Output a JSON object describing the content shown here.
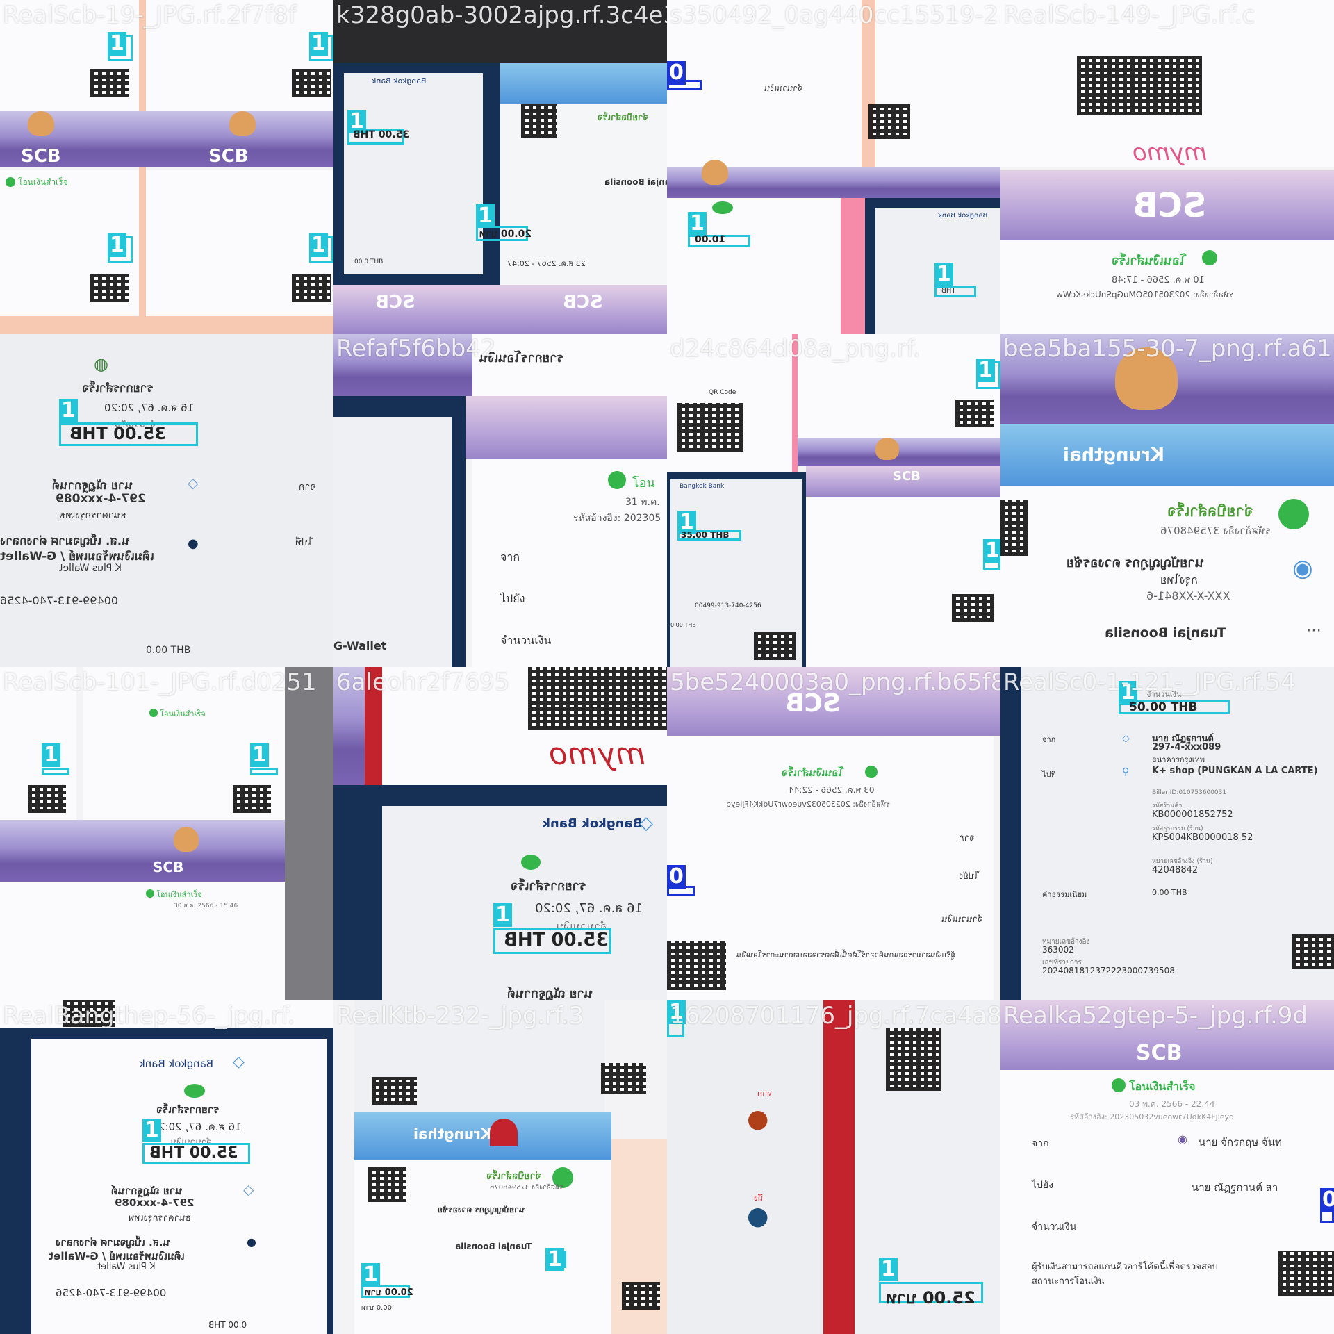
{
  "mosaic": {
    "tiles": [
      {
        "source": "RealScb-19-_JPG.rf.2f7f8f",
        "boxes": [
          {
            "label": "1",
            "value": ""
          },
          {
            "label": "1",
            "value": ""
          },
          {
            "label": "1",
            "value": ""
          },
          {
            "label": "1",
            "value": ""
          }
        ],
        "texts": [
          "โอนเงินสำเร็จ",
          "SCB",
          "SCB"
        ]
      },
      {
        "source": "k328g0ab-3002ajpg.rf.3c4e34",
        "boxes": [
          {
            "label": "1",
            "value": "35.00 THB"
          },
          {
            "label": "1",
            "value": "20.00 บาท"
          }
        ],
        "texts": [
          "Bangkok Bank",
          "จ่ายบิลสำเร็จ",
          "Tuanjai Boonsila",
          "23 ส.ค. 2567 - 20:47",
          "00.0 THB",
          "SCB",
          "SCB"
        ]
      },
      {
        "source": "s350492_0ag440cc15519-25fa6",
        "boxes": [
          {
            "label": "0",
            "value": ""
          },
          {
            "label": "1",
            "value": "10.00"
          },
          {
            "label": "1",
            "value": "THB"
          }
        ],
        "texts": [
          "จำนวนเงิน",
          "Bangkok Bank"
        ]
      },
      {
        "source": "RealScb-149-_JPG.rf.c",
        "boxes": [],
        "texts": [
          "SCB",
          "โอนเงินสำเร็จ",
          "10 พ.ค. 2566 - 17:48",
          "รหัสอ้างอิง: 202305105OMuGpSnUcksKcWw"
        ]
      },
      {
        "source": "",
        "boxes": [
          {
            "label": "1",
            "value": "35.00 THB"
          }
        ],
        "texts": [
          "รายการสำเร็จ",
          "16 ส.ค. 67, 20:20",
          "จำนวนเงิน",
          "นาย ณัฏฐกานต์",
          "297-4-xxx089",
          "ธนาคารกรุงเทพ",
          "น.ส. เบ็ญจมาศ ด่างกลาง",
          "เติมเงินพร้อมเพย์ / G-Wallet",
          "K Plus Wallet",
          "00499-913-740-4256",
          "0.00 THB",
          "จาก",
          "ไปที่"
        ]
      },
      {
        "source": "Refaf5f6bb42",
        "boxes": [],
        "texts": [
          "รายการโอนเงิน",
          "31 พ.ค.",
          "รหัสอ้างอิง: 202305",
          "จาก",
          "ไปยัง",
          "จำนวนเงิน",
          "G-Wallet"
        ]
      },
      {
        "source": "d24c864d08a_png.rf.",
        "boxes": [
          {
            "label": "1",
            "value": ""
          },
          {
            "label": "1",
            "value": "35.00 THB"
          },
          {
            "label": "1",
            "value": ""
          }
        ],
        "texts": [
          "QR Code",
          "Bangkok Bank",
          "SCB",
          "00499-913-740-4256",
          "0.00 THB"
        ]
      },
      {
        "source": "bea5ba155-30-7_png.rf.a6114",
        "boxes": [],
        "texts": [
          "Krungthai",
          "จ่ายบิลสำเร็จ",
          "รหัสอ้างอิง 375948076",
          "นายบัญญูภูกร ดวงอรชัย",
          "กรุงไทย",
          "XXX-X-XX841-6",
          "Tuanjai Boonsila"
        ]
      },
      {
        "source": "RealScb-101-_JPG.rf.d0251",
        "boxes": [
          {
            "label": "1",
            "value": ""
          },
          {
            "label": "1",
            "value": ""
          }
        ],
        "texts": [
          "โอนเงินสำเร็จ",
          "SCB",
          "โอนเงินสำเร็จ",
          "30 ส.ค. 2566 - 15:46"
        ]
      },
      {
        "source": "6aleohr2f7695",
        "boxes": [
          {
            "label": "1",
            "value": "35.00 THB"
          }
        ],
        "texts": [
          "Bangkok Bank",
          "รายการสำเร็จ",
          "16 ส.ค. 67, 20:20",
          "จำนวนเงิน",
          "นาย ณัฏฐกานต์",
          "mymo"
        ]
      },
      {
        "source": "5be5240003a0_png.rf.b65f8f",
        "boxes": [
          {
            "label": "0",
            "value": ""
          }
        ],
        "texts": [
          "SCB",
          "โอนเงินสำเร็จ",
          "03 พ.ค. 2566 - 22:44",
          "รหัสอ้างอิง: 202305032vueowr7UdkK4Fjleyd",
          "จาก",
          "ไปยัง",
          "จำนวนเงิน",
          "ผู้รับเงินสามารถสแกนคิวอาร์โค้ดนี้เพื่อตรวจสอบสถานะการโอนเงิน"
        ]
      },
      {
        "source": "RealSc0-1-121-_JPG.rf.54",
        "boxes": [
          {
            "label": "1",
            "value": "50.00 THB"
          }
        ],
        "texts": [
          "จำนวนเงิน",
          "นาย ณัฏฐกานต์",
          "297-4-xxx089",
          "ธนาคารกรุงเทพ",
          "K+ shop (PUNGKAN A LA CARTE)",
          "Biller ID:010753600031",
          "รหัสร้านค้า",
          "KB000001852752",
          "รหัสธุรกรรม (ร้าน)",
          "KPS004KB0000018 52",
          "หมายเลขอ้างอิง (ร้าน)",
          "42048842",
          "ค่าธรรมเนียม",
          "0.00 THB",
          "หมายเลขอ้างอิง",
          "363002",
          "เลขที่รายการ",
          "2024081812372223000739508",
          "จาก",
          "ไปที่"
        ]
      },
      {
        "source": "RealBangthep-56-_jpg.rf.",
        "boxes": [
          {
            "label": "1",
            "value": "35.00 THB"
          }
        ],
        "texts": [
          "Bangkok Bank",
          "รายการสำเร็จ",
          "16 ส.ค. 67, 20:2",
          "จำนวนเงิน",
          "นาย ณัฏฐกานต์",
          "297-4-xxx089",
          "ธนาคารกรุงเทพ",
          "น.ส. เบ็ญจมาศ ด่างกลาง",
          "เติมเงินพร้อมเพย์ / G-Wallet",
          "K Plus Wallet",
          "00499-913-740-4256",
          "0.00 THB"
        ]
      },
      {
        "source": "RealKtb-232-_jpg.rf.3",
        "boxes": [
          {
            "label": "1",
            "value": ""
          },
          {
            "label": "1",
            "value": "20.00 บาท"
          }
        ],
        "texts": [
          "Krungthai",
          "จ่ายบิลสำเร็จ",
          "รหัสอ้างอิง 375948076",
          "นายบัญญูภูกร ดวงอรชัย",
          "Tuanjai Boonsila",
          "00.0 บาท"
        ]
      },
      {
        "source": "16208701176_jpg.rf.7ca4a83",
        "boxes": [
          {
            "label": "1",
            "value": ""
          },
          {
            "label": "1",
            "value": "25.00 บาท"
          }
        ],
        "texts": [
          "จาก",
          "ถึง"
        ]
      },
      {
        "source": "Realka52gtep-5-_jpg.rf.9d",
        "boxes": [
          {
            "label": "0",
            "value": ""
          }
        ],
        "texts": [
          "SCB",
          "โอนเงินสำเร็จ",
          "03 พ.ค. 2566 - 22:44",
          "รหัสอ้างอิง: 202305032vueowr7UdkK4Fjleyd",
          "จาก",
          "นาย จักรกฤษ จันท",
          "ไปยัง",
          "นาย ณัฏฐกานต์ สา",
          "จำนวนเงิน",
          "ผู้รับเงินสามารถสแกนคิวอาร์โค้ดนี้เพื่อตรวจสอบสถานะการโอนเงิน"
        ]
      }
    ]
  },
  "colors": {
    "box_cyan": "#22c6d8",
    "box_blue": "#1b33d6",
    "scb_purple": "#6f5aa7",
    "success_green": "#35b54a",
    "bangkok_navy": "#163055",
    "krungthai_blue": "#4f95da"
  }
}
